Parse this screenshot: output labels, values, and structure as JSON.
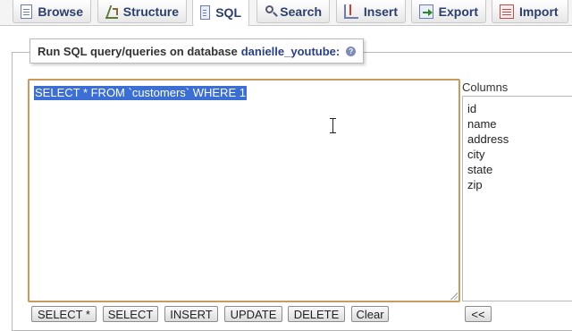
{
  "tabs": [
    {
      "label": "Browse",
      "icon": "browse-icon"
    },
    {
      "label": "Structure",
      "icon": "structure-icon"
    },
    {
      "label": "SQL",
      "icon": "sql-icon",
      "active": true
    },
    {
      "label": "Search",
      "icon": "search-icon"
    },
    {
      "label": "Insert",
      "icon": "insert-icon"
    },
    {
      "label": "Export",
      "icon": "export-icon"
    },
    {
      "label": "Import",
      "icon": "import-icon"
    }
  ],
  "query_panel": {
    "legend_prefix": "Run SQL query/queries on database",
    "database": "danielle_youtube:",
    "help_icon": "?",
    "sql_text": "SELECT * FROM `customers` WHERE 1"
  },
  "columns": {
    "label": "Columns",
    "items": [
      "id",
      "name",
      "address",
      "city",
      "state",
      "zip"
    ]
  },
  "buttons": {
    "select_star": "SELECT *",
    "select": "SELECT",
    "insert": "INSERT",
    "update": "UPDATE",
    "delete": "DELETE",
    "clear": "Clear",
    "insert_column": "<<"
  },
  "colors": {
    "selection": "#3b6fd6",
    "textarea_border": "#c89b5a",
    "tab_text": "#2a3f6b",
    "db_name": "#2a3f8b"
  }
}
